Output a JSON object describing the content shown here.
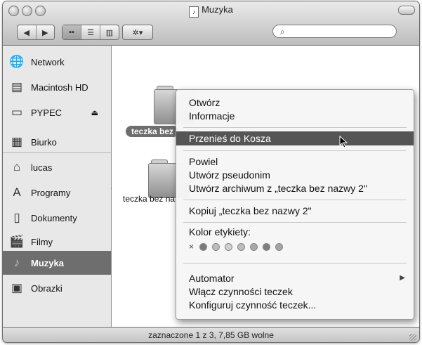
{
  "window": {
    "title": "Muzyka"
  },
  "toolbar": {
    "back": "◀",
    "forward": "▶",
    "view_icons": "▪▪",
    "view_list": "☰",
    "view_columns": "▥",
    "action": "✲▾",
    "search_icon": "🔍",
    "search_value": ""
  },
  "sidebar": {
    "devices": [
      {
        "label": "Network",
        "icon": "globe-icon"
      },
      {
        "label": "Macintosh HD",
        "icon": "harddisk-icon"
      },
      {
        "label": "PYPEC",
        "icon": "drive-icon"
      }
    ],
    "places": [
      {
        "label": "Biurko",
        "icon": "desktop-icon"
      },
      {
        "label": "lucas",
        "icon": "home-icon"
      },
      {
        "label": "Programy",
        "icon": "applications-icon"
      },
      {
        "label": "Dokumenty",
        "icon": "documents-icon"
      },
      {
        "label": "Filmy",
        "icon": "movies-icon"
      },
      {
        "label": "Muzyka",
        "icon": "music-icon",
        "selected": true
      },
      {
        "label": "Obrazki",
        "icon": "pictures-icon"
      }
    ]
  },
  "content": {
    "items": [
      {
        "label": "teczka bez ",
        "selected": true
      },
      {
        "label": "teczka bez na"
      }
    ]
  },
  "context_menu": {
    "items_group1": [
      "Otwórz",
      "Informacje"
    ],
    "move_to_trash": "Przenieś do Kosza",
    "items_group2": [
      "Powiel",
      "Utwórz pseudonim",
      "Utwórz archiwum z „teczka bez nazwy 2\""
    ],
    "copy": "Kopiuj „teczka bez nazwy 2\"",
    "label_color_heading": "Kolor etykiety:",
    "label_colors": [
      "×",
      "#7a7a7a",
      "#bcbcbc",
      "#d0d0d0",
      "#bdbdbd",
      "#a8a8a8",
      "#7f7f7f",
      "#a4a4a4"
    ],
    "automator": "Automator",
    "items_group3": [
      "Włącz czynności teczek",
      "Konfiguruj czynność teczek..."
    ]
  },
  "status": {
    "text": "zaznaczone 1 z 3, 7,85 GB wolne"
  }
}
